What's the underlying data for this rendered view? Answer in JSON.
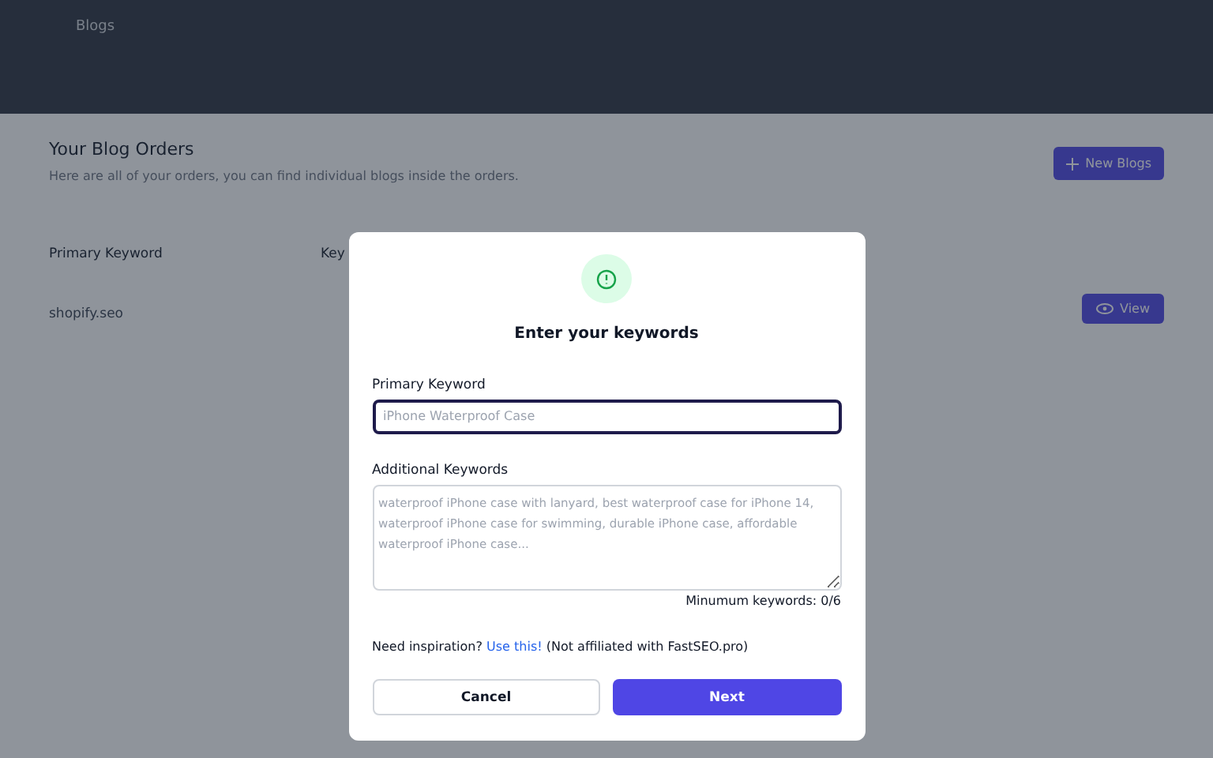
{
  "header": {
    "nav_label": "Blogs"
  },
  "page": {
    "title": "Your Blog Orders",
    "subtitle": "Here are all of your orders, you can find individual blogs inside the orders.",
    "new_button": "New Blogs"
  },
  "table": {
    "columns": [
      "Primary Keyword",
      "Key"
    ],
    "rows": [
      {
        "cells": [
          "shopify.seo"
        ],
        "action": "View"
      }
    ]
  },
  "dialog": {
    "title": "Enter your keywords",
    "primary": {
      "label": "Primary Keyword",
      "placeholder": "iPhone Waterproof Case",
      "focused": true
    },
    "additional": {
      "label": "Additional Keywords",
      "placeholder": "waterproof iPhone case with lanyard, best waterproof case for iPhone 14, waterproof iPhone case for swimming, durable iPhone case, affordable waterproof iPhone case..."
    },
    "counter": "Minumum keywords: 0/6",
    "inspiration": {
      "before": "Need inspiration?",
      "link": "Use this!",
      "after": "(Not affiliated with FastSEO.pro)"
    },
    "buttons": [
      {
        "kind": "secondary",
        "label": "Cancel"
      },
      {
        "kind": "primary",
        "label": "Next"
      }
    ]
  }
}
